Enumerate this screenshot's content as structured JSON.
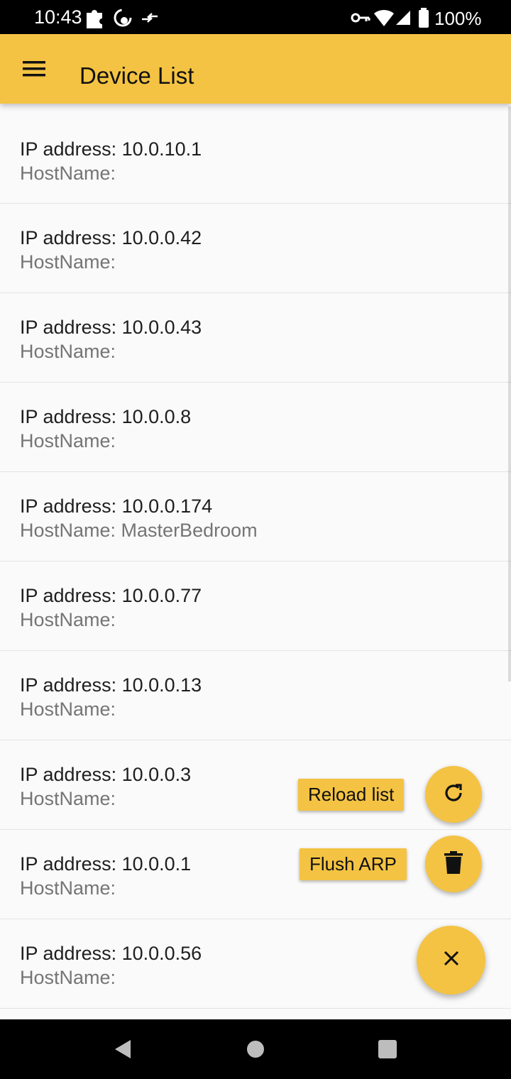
{
  "status_bar": {
    "time": "10:43",
    "battery": "100%",
    "icons": [
      "puzzle-icon",
      "sync-icon",
      "data-arrows-icon",
      "vpn-key-icon",
      "wifi-icon",
      "cellular-signal-icon",
      "battery-icon"
    ]
  },
  "app_bar": {
    "title": "Device List",
    "menu_icon": "hamburger-menu-icon"
  },
  "devices": [
    {
      "ip": "IP address: 10.0.10.1",
      "host": "HostName:"
    },
    {
      "ip": "IP address: 10.0.0.42",
      "host": "HostName:"
    },
    {
      "ip": "IP address: 10.0.0.43",
      "host": "HostName:"
    },
    {
      "ip": "IP address: 10.0.0.8",
      "host": "HostName:"
    },
    {
      "ip": "IP address: 10.0.0.174",
      "host": "HostName: MasterBedroom"
    },
    {
      "ip": "IP address: 10.0.0.77",
      "host": "HostName:"
    },
    {
      "ip": "IP address: 10.0.0.13",
      "host": "HostName:"
    },
    {
      "ip": "IP address: 10.0.0.3",
      "host": "HostName:"
    },
    {
      "ip": "IP address: 10.0.0.1",
      "host": "HostName:"
    },
    {
      "ip": "IP address: 10.0.0.56",
      "host": "HostName:"
    }
  ],
  "fab_menu": {
    "reload_label": "Reload list",
    "flush_label": "Flush ARP",
    "reload_icon": "refresh-icon",
    "flush_icon": "trash-icon",
    "close_icon": "close-icon"
  },
  "nav_bar": {
    "icons": [
      "back-icon",
      "home-icon",
      "recents-icon"
    ]
  },
  "colors": {
    "accent": "#f4c343",
    "status_bar": "#000000",
    "background": "#fafafa",
    "hostname_text": "#757575"
  }
}
